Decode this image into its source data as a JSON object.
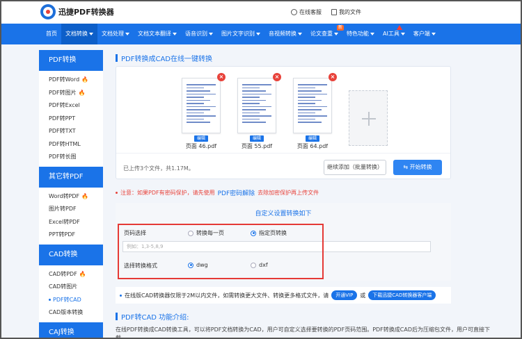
{
  "header": {
    "logo_text": "迅捷PDF转换器",
    "service_link": "在线客服",
    "my_files_link": "我的文件"
  },
  "nav": {
    "items": [
      {
        "label": "首页",
        "dropdown": false
      },
      {
        "label": "文档转换",
        "dropdown": true,
        "active": true
      },
      {
        "label": "文档处理",
        "dropdown": true
      },
      {
        "label": "文档文本翻译",
        "dropdown": true
      },
      {
        "label": "语音识别",
        "dropdown": true
      },
      {
        "label": "图片文字识别",
        "dropdown": true
      },
      {
        "label": "音视频转换",
        "dropdown": true
      },
      {
        "label": "论文查重",
        "dropdown": true,
        "badge": "新"
      },
      {
        "label": "特色功能",
        "dropdown": true
      },
      {
        "label": "AI工具",
        "dropdown": true,
        "arrow": true
      },
      {
        "label": "客户端",
        "dropdown": true
      }
    ]
  },
  "sidebar": {
    "sections": [
      {
        "title": "PDF转换",
        "items": [
          {
            "label": "PDF转Word",
            "hot": true
          },
          {
            "label": "PDF转图片",
            "hot": true
          },
          {
            "label": "PDF转Excel"
          },
          {
            "label": "PDF转PPT"
          },
          {
            "label": "PDF转TXT"
          },
          {
            "label": "PDF转HTML"
          },
          {
            "label": "PDF转长图"
          }
        ]
      },
      {
        "title": "其它转PDF",
        "items": [
          {
            "label": "Word转PDF",
            "hot": true
          },
          {
            "label": "图片转PDF"
          },
          {
            "label": "Excel转PDF"
          },
          {
            "label": "PPT转PDF"
          }
        ]
      },
      {
        "title": "CAD转换",
        "items": [
          {
            "label": "CAD转PDF",
            "hot": true
          },
          {
            "label": "CAD转图片"
          },
          {
            "label": "PDF转CAD",
            "selected": true
          },
          {
            "label": "CAD版本转换"
          }
        ]
      },
      {
        "title": "CAJ转换",
        "items": []
      }
    ]
  },
  "main": {
    "title": "PDF转换成CAD在线一键转换",
    "files": [
      {
        "name": "页面 46.pdf",
        "edit_label": "编辑",
        "remove": "×"
      },
      {
        "name": "页面 55.pdf",
        "edit_label": "编辑",
        "remove": "×"
      },
      {
        "name": "页面 64.pdf",
        "edit_label": "编辑",
        "remove": "×"
      }
    ],
    "upload_status": "已上传3个文件，共1.17M。",
    "continue_button": "继续添加（批量转换）",
    "start_button": "开始转换",
    "note_prefix": "注意：如果PDF有密码保护，请先使用",
    "note_link": "PDF密码解除",
    "note_suffix": "去除加密保护再上传文件",
    "options": {
      "title": "自定义设置转换如下",
      "page_label": "页码选择",
      "page_opt1": "转换每一页",
      "page_opt2": "指定页转换",
      "page_placeholder": "例如：1,3-5,8,9",
      "format_label": "选择转换格式",
      "format_opt1": "dwg",
      "format_opt2": "dxf"
    },
    "info_text": "在线版CAD转换器仅限于2M以内文件，如需转换更大文件、转换更多格式文件，请",
    "vip_button": "开通VIP",
    "or_text": "或",
    "download_button": "下载迅捷CAD转换器客户端",
    "intro_title": "PDF转CAD 功能介绍:",
    "intro_text": "在线PDF转换成CAD转换工具，可以将PDF文档转换为CAD，用户可自定义选择要转换的PDF页码范围。PDF转换成CAD后为压缩包文件，用户可直接下载。"
  }
}
